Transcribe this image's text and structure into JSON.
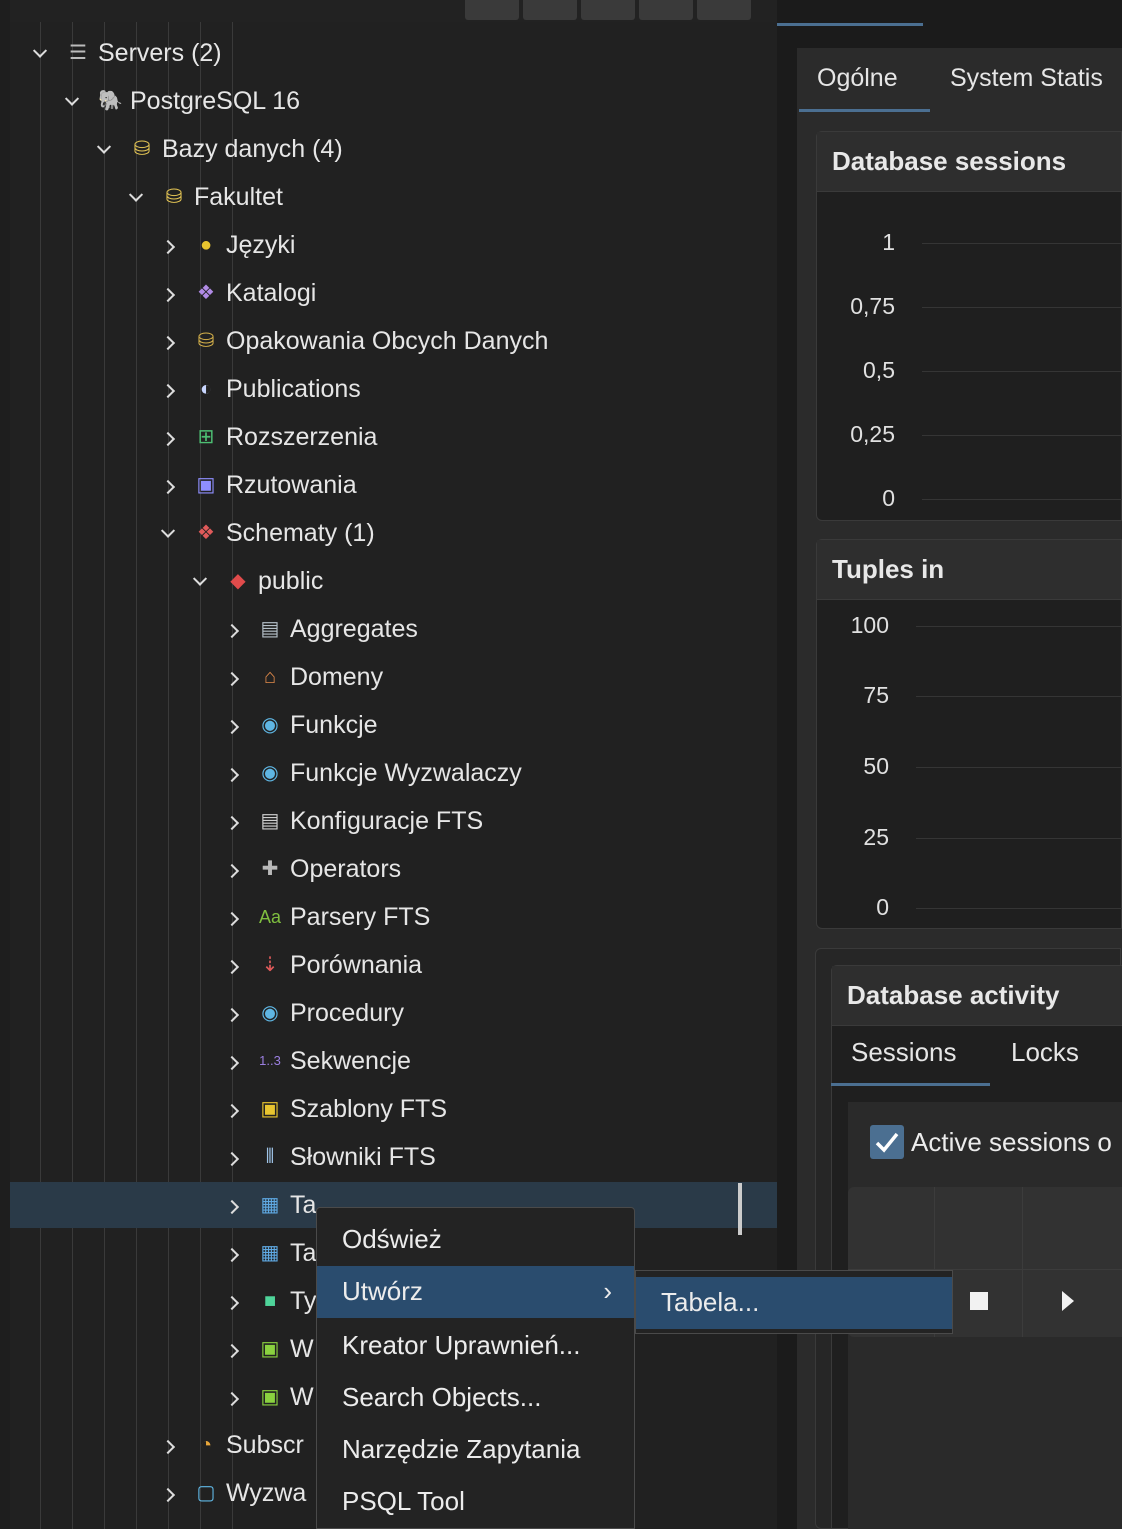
{
  "tree": {
    "items": [
      {
        "label": "Servers (2)",
        "icon": "server-icon",
        "state": "open"
      },
      {
        "label": "PostgreSQL 16",
        "icon": "postgresql-elephant-icon",
        "state": "open"
      },
      {
        "label": "Bazy danych (4)",
        "icon": "databases-icon",
        "state": "open"
      },
      {
        "label": "Fakultet",
        "icon": "database-icon",
        "state": "open"
      },
      {
        "label": "Języki",
        "icon": "languages-icon",
        "state": "closed"
      },
      {
        "label": "Katalogi",
        "icon": "catalogs-icon",
        "state": "closed"
      },
      {
        "label": "Opakowania Obcych Danych",
        "icon": "foreign-data-wrapper-icon",
        "state": "closed"
      },
      {
        "label": "Publications",
        "icon": "publication-icon",
        "state": "closed"
      },
      {
        "label": "Rozszerzenia",
        "icon": "extension-icon",
        "state": "closed"
      },
      {
        "label": "Rzutowania",
        "icon": "cast-icon",
        "state": "closed"
      },
      {
        "label": "Schematy (1)",
        "icon": "schemas-icon",
        "state": "open"
      },
      {
        "label": "public",
        "icon": "schema-icon",
        "state": "open"
      },
      {
        "label": "Aggregates",
        "icon": "aggregate-icon",
        "state": "closed"
      },
      {
        "label": "Domeny",
        "icon": "domain-icon",
        "state": "closed"
      },
      {
        "label": "Funkcje",
        "icon": "function-icon",
        "state": "closed"
      },
      {
        "label": "Funkcje Wyzwalaczy",
        "icon": "trigger-function-icon",
        "state": "closed"
      },
      {
        "label": "Konfiguracje FTS",
        "icon": "fts-configuration-icon",
        "state": "closed"
      },
      {
        "label": "Operators",
        "icon": "operator-icon",
        "state": "closed"
      },
      {
        "label": "Parsery FTS",
        "icon": "fts-parser-icon",
        "state": "closed"
      },
      {
        "label": "Porównania",
        "icon": "collation-icon",
        "state": "closed"
      },
      {
        "label": "Procedury",
        "icon": "procedure-icon",
        "state": "closed"
      },
      {
        "label": "Sekwencje",
        "icon": "sequence-icon",
        "state": "closed"
      },
      {
        "label": "Szablony FTS",
        "icon": "fts-template-icon",
        "state": "closed"
      },
      {
        "label": "Słowniki FTS",
        "icon": "fts-dictionary-icon",
        "state": "closed"
      },
      {
        "label": "Ta",
        "icon": "table-icon",
        "state": "closed"
      },
      {
        "label": "Ta",
        "icon": "foreign-table-icon",
        "state": "closed"
      },
      {
        "label": "Ty",
        "icon": "type-icon",
        "state": "closed"
      },
      {
        "label": "W",
        "icon": "view-icon",
        "state": "closed"
      },
      {
        "label": "W",
        "icon": "materialized-view-icon",
        "state": "closed"
      },
      {
        "label": "Subscr",
        "icon": "subscription-icon",
        "state": "closed"
      },
      {
        "label": "Wyzwa",
        "icon": "event-trigger-icon",
        "state": "closed"
      }
    ]
  },
  "right": {
    "tabs": [
      "Ogólne",
      "System Statis"
    ],
    "sessions_card": {
      "title": "Database sessions",
      "ticks": [
        "1",
        "0,75",
        "0,5",
        "0,25",
        "0"
      ]
    },
    "tuples_card": {
      "title": "Tuples in",
      "ticks": [
        "100",
        "75",
        "50",
        "25",
        "0"
      ]
    },
    "activity_card": {
      "title": "Database activity",
      "tabs": [
        "Sessions",
        "Locks"
      ],
      "checkbox_label": "Active sessions o"
    }
  },
  "context_menu": {
    "items": [
      "Odśwież",
      "Utwórz",
      "Kreator Uprawnień...",
      "Search Objects...",
      "Narzędzie Zapytania",
      "PSQL Tool"
    ],
    "submenu_arrow": "›",
    "submenu": {
      "items": [
        "Tabela..."
      ]
    }
  },
  "colors": {
    "accent": "#4b6f91",
    "menu_highlight": "#2a4c6e",
    "selected_row": "#2a3a48"
  }
}
